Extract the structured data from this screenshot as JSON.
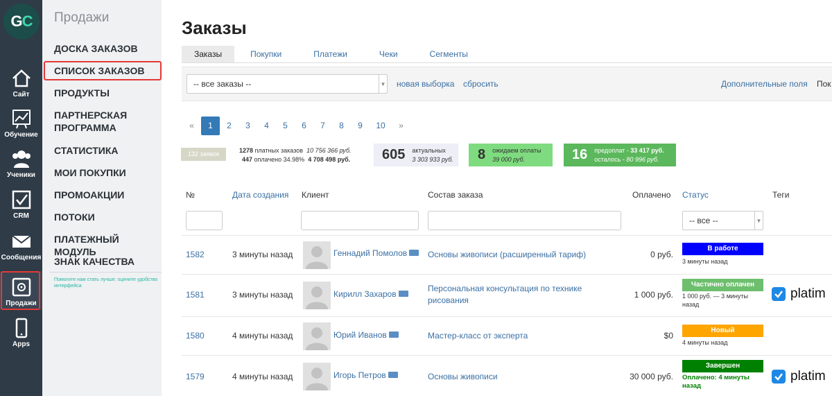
{
  "iconbar": {
    "logo": {
      "left": "G",
      "right": "C"
    },
    "items": [
      {
        "label": "Сайт",
        "icon": "home-icon"
      },
      {
        "label": "Обучение",
        "icon": "chart-board-icon"
      },
      {
        "label": "Ученики",
        "icon": "users-icon"
      },
      {
        "label": "CRM",
        "icon": "checkbox-icon"
      },
      {
        "label": "Сообщения",
        "icon": "envelope-icon"
      },
      {
        "label": "Продажи",
        "icon": "safe-icon"
      },
      {
        "label": "Apps",
        "icon": "phone-icon"
      }
    ]
  },
  "submenu": {
    "title": "Продажи",
    "items": [
      "Доска заказов",
      "Список заказов",
      "Продукты",
      "Партнерская программа",
      "Статистика",
      "Мои покупки",
      "Промоакции",
      "Потоки",
      "Платежный модуль",
      "Знак качества"
    ],
    "feedback": "Помогите нам стать лучше: оцените удобство интерфейса"
  },
  "page": {
    "title": "Заказы"
  },
  "tabs": [
    "Заказы",
    "Покупки",
    "Платежи",
    "Чеки",
    "Сегменты"
  ],
  "filter": {
    "select_value": "-- все заказы --",
    "new_selection": "новая выборка",
    "reset": "сбросить",
    "extra_fields": "Дополнительные поля",
    "cut_link": "Пок"
  },
  "pager": {
    "prev": "«",
    "pages": [
      "1",
      "2",
      "3",
      "4",
      "5",
      "6",
      "7",
      "8",
      "9",
      "10"
    ],
    "next": "»",
    "current": "1"
  },
  "stats": {
    "orders_badge": "132 заявок",
    "paid_count": "1278",
    "paid_label": "платных заказов",
    "paid_sum": "10 756 366 руб.",
    "paid_done_count": "447",
    "paid_done_label": "оплачено 34.98%",
    "paid_done_sum": "4 708 498 руб.",
    "actual_num": "605",
    "actual_label": "актуальных",
    "actual_sum": "3 303 933 руб.",
    "wait_num": "8",
    "wait_label": "ожидаем оплаты",
    "wait_sum": "39 000 руб.",
    "prepay_num": "16",
    "prepay_label": "предоплат - ",
    "prepay_sum": "33 417 руб.",
    "remain_label": "осталось - ",
    "remain_sum": "80 996 руб."
  },
  "table": {
    "headers": {
      "num": "№",
      "date": "Дата создания",
      "client": "Клиент",
      "items": "Состав заказа",
      "paid": "Оплачено",
      "status": "Статус",
      "tags": "Теги"
    },
    "status_filter": "-- все --",
    "rows": [
      {
        "id": "1582",
        "date": "3 минуты назад",
        "client": "Геннадий Помолов",
        "items": "Основы живописи (расширенный тариф)",
        "paid": "0 руб.",
        "status": "В работе",
        "status_color": "#0000ff",
        "status_sub": "3 минуты назад",
        "tag": ""
      },
      {
        "id": "1581",
        "date": "3 минуты назад",
        "client": "Кирилл Захаров",
        "items": "Персональная консультация по технике рисования",
        "paid": "1 000 руб.",
        "status": "Частично оплачен",
        "status_color": "#6dbf6d",
        "status_sub": "1 000 руб. — 3 минуты назад",
        "tag": "platim"
      },
      {
        "id": "1580",
        "date": "4 минуты назад",
        "client": "Юрий Иванов",
        "items": "Мастер-класс от эксперта",
        "paid": "$0",
        "status": "Новый",
        "status_color": "#ffa500",
        "status_sub": "4 минуты назад",
        "tag": ""
      },
      {
        "id": "1579",
        "date": "4 минуты назад",
        "client": "Игорь Петров",
        "items": "Основы живописи",
        "paid": "30 000 руб.",
        "status": "Завершен",
        "status_color": "#008000",
        "status_sub": "Оплачено: 4 минуты назад",
        "tag": "platim"
      }
    ]
  }
}
